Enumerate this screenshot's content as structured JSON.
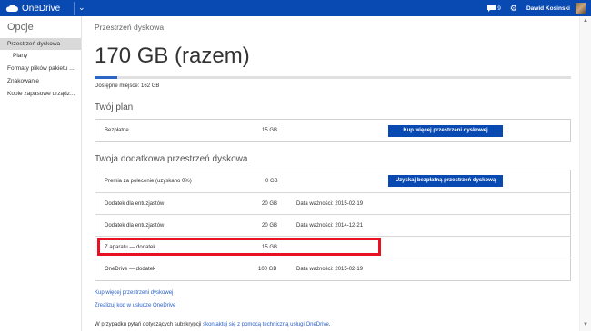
{
  "topbar": {
    "brand": "OneDrive",
    "message_count": "9",
    "user_name": "Dawid Kosinski"
  },
  "sidebar": {
    "title": "Opcje",
    "items": [
      {
        "label": "Przestrzeń dyskowa"
      },
      {
        "label": "Plany"
      },
      {
        "label": "Formaty plików pakietu ..."
      },
      {
        "label": "Znakowanie"
      },
      {
        "label": "Kopie zapasowe urządz..."
      }
    ]
  },
  "main": {
    "section_title": "Przestrzeń dyskowa",
    "total": "170 GB (razem)",
    "usage_fraction": 0.047,
    "available": "Dostępne miejsce: 162 GB",
    "plan_heading": "Twój plan",
    "plan": {
      "name": "Bezpłatne",
      "size": "15 GB",
      "button": "Kup więcej przestrzeni dyskowej"
    },
    "extra_heading": "Twoja dodatkowa przestrzeń dyskowa",
    "extras": [
      {
        "name": "Premia za polecenie (uzyskano 0%)",
        "size": "0 GB",
        "note": "",
        "button": "Uzyskaj bezpłatną przestrzeń dyskową"
      },
      {
        "name": "Dodatek dla entuzjastów",
        "size": "20 GB",
        "note": "Data ważności: 2015-02-19"
      },
      {
        "name": "Dodatek dla entuzjastów",
        "size": "20 GB",
        "note": "Data ważności: 2014-12-21"
      },
      {
        "name": "Z aparatu — dodatek",
        "size": "15 GB",
        "note": ""
      },
      {
        "name": "OneDrive — dodatek",
        "size": "100 GB",
        "note": "Data ważności: 2015-02-19"
      }
    ],
    "link_buy": "Kup więcej przestrzeni dyskowej",
    "link_redeem": "Zrealizuj kod w usłudze OneDrive",
    "footnote_pre": "W przypadku pytań dotyczących subskrypcji",
    "footnote_link": "skontaktuj się z pomocą techniczną usługi OneDrive",
    "footnote_post": "."
  },
  "colors": {
    "brand": "#094ab2",
    "highlight": "#e81123",
    "link": "#2a62c4"
  }
}
